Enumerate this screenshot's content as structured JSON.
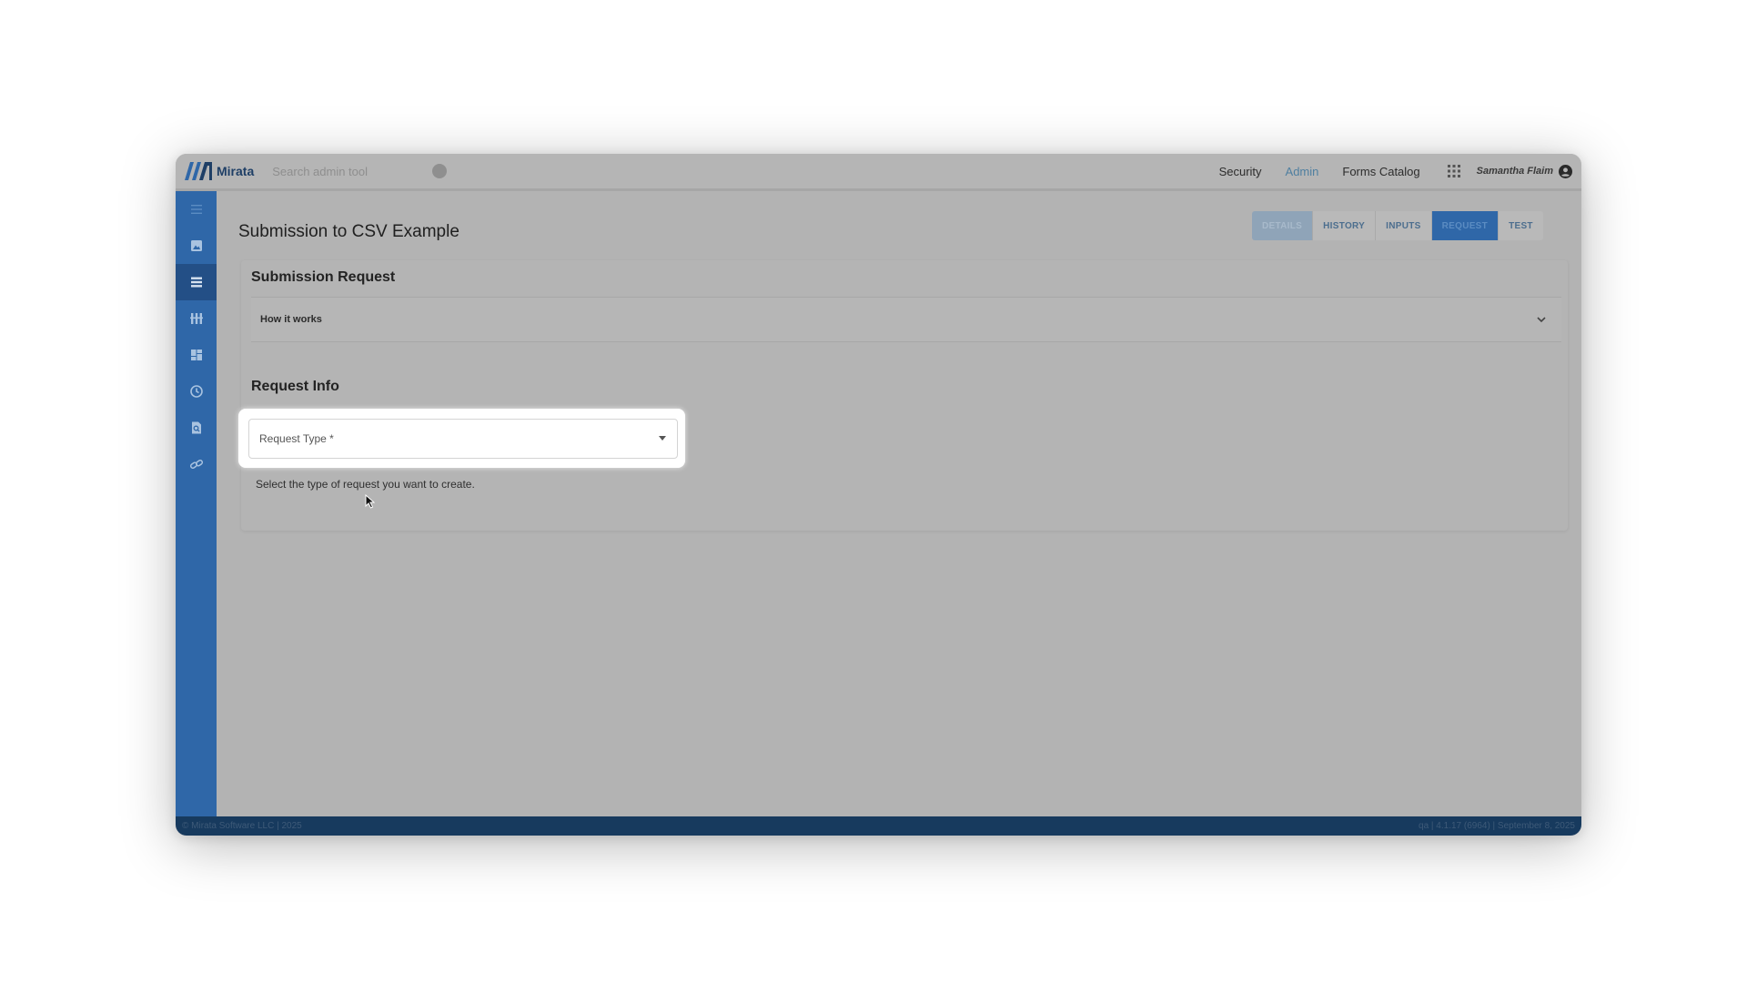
{
  "app": {
    "brand_name": "Mirata",
    "search_placeholder": "Search admin tool"
  },
  "header_nav": {
    "links": [
      "Security",
      "Admin",
      "Forms Catalog"
    ],
    "active": "Admin",
    "user_name": "Samantha Flaim"
  },
  "sidebar": {
    "icons": [
      "menu-icon",
      "image-icon",
      "list-icon",
      "columns-icon",
      "dashboard-icon",
      "history-icon",
      "document-search-icon",
      "link-icon"
    ],
    "active_index": 2
  },
  "page": {
    "title": "Submission to CSV Example",
    "tabs": [
      "DETAILS",
      "HISTORY",
      "INPUTS",
      "REQUEST",
      "TEST"
    ],
    "active_tab": "REQUEST"
  },
  "submission": {
    "title": "Submission Request",
    "accordion_label": "How it works"
  },
  "request_info": {
    "title": "Request Info",
    "field_label": "Request Type *",
    "helper_text": "Select the type of request you want to create."
  },
  "footer": {
    "left": "© Mirata Software LLC | 2025",
    "right": "qa | 4.1.17 (6964) | September 8, 2025"
  },
  "colors": {
    "sidebar": "#2f67a8",
    "footer": "#173a5e",
    "overlay": "#b3b3b3",
    "active_tab": "#2f67a8"
  }
}
